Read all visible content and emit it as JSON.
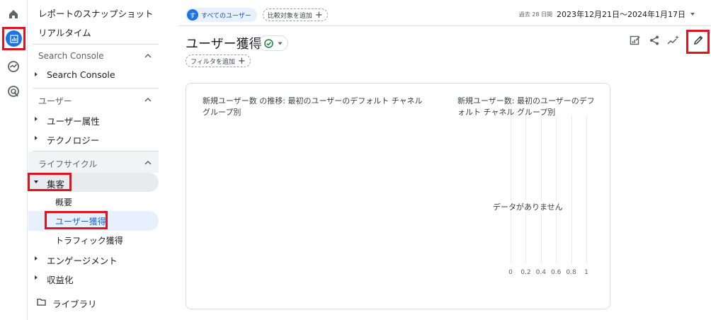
{
  "sidebar": {
    "snapshot": "レポートのスナップショット",
    "realtime": "リアルタイム",
    "sections": [
      {
        "label": "Search Console",
        "items": [
          "Search Console"
        ]
      },
      {
        "label": "ユーザー",
        "items": [
          "ユーザー属性",
          "テクノロジー"
        ]
      },
      {
        "label": "ライフサイクル"
      }
    ],
    "acquisition": "集客",
    "acq_children": [
      "概要",
      "ユーザー獲得",
      "トラフィック獲得"
    ],
    "engagement": "エンゲージメント",
    "monetization": "収益化",
    "library": "ライブラリ"
  },
  "topbar": {
    "segment_initial": "す",
    "segment_label": "すべてのユーザー",
    "compare_label": "比較対象を追加",
    "date_prefix": "過去 28 日間",
    "date_range": "2023年12月21日～2024年1月17日"
  },
  "page": {
    "title": "ユーザー獲得",
    "filter_label": "フィルタを追加"
  },
  "card": {
    "chart1_title": "新規ユーザー数 の推移: 最初のユーザーのデフォルト チャネルグループ別",
    "chart2_title": "新規ユーザー数: 最初のユーザーのデフォルト チャネル グループ別",
    "no_data": "データがありません",
    "ticks": [
      "0",
      "0.2",
      "0.4",
      "0.6",
      "0.8",
      "1"
    ]
  },
  "chart_data": {
    "type": "bar",
    "title": "新規ユーザー数: 最初のユーザーのデフォルト チャネル グループ別",
    "x_ticks": [
      0,
      0.2,
      0.4,
      0.6,
      0.8,
      1
    ],
    "xlim": [
      0,
      1
    ],
    "categories": [],
    "values": [],
    "grid": true
  },
  "colors": {
    "accent": "#1a73e8",
    "highlight_box": "#e0141e",
    "active_bg": "#e8f0fe"
  }
}
